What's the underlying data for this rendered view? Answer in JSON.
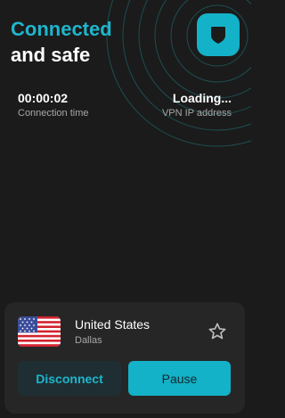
{
  "header": {
    "title_line1": "Connected",
    "title_line2": "and safe",
    "shield_icon": "shield-icon",
    "accent_color": "#1eb6cd"
  },
  "stats": {
    "time_value": "00:00:02",
    "time_label": "Connection time",
    "ip_value": "Loading...",
    "ip_label": "VPN IP address"
  },
  "location": {
    "country": "United States",
    "city": "Dallas",
    "flag_icon": "us-flag-icon",
    "favorite_icon": "star-icon"
  },
  "actions": {
    "disconnect_label": "Disconnect",
    "pause_label": "Pause"
  }
}
